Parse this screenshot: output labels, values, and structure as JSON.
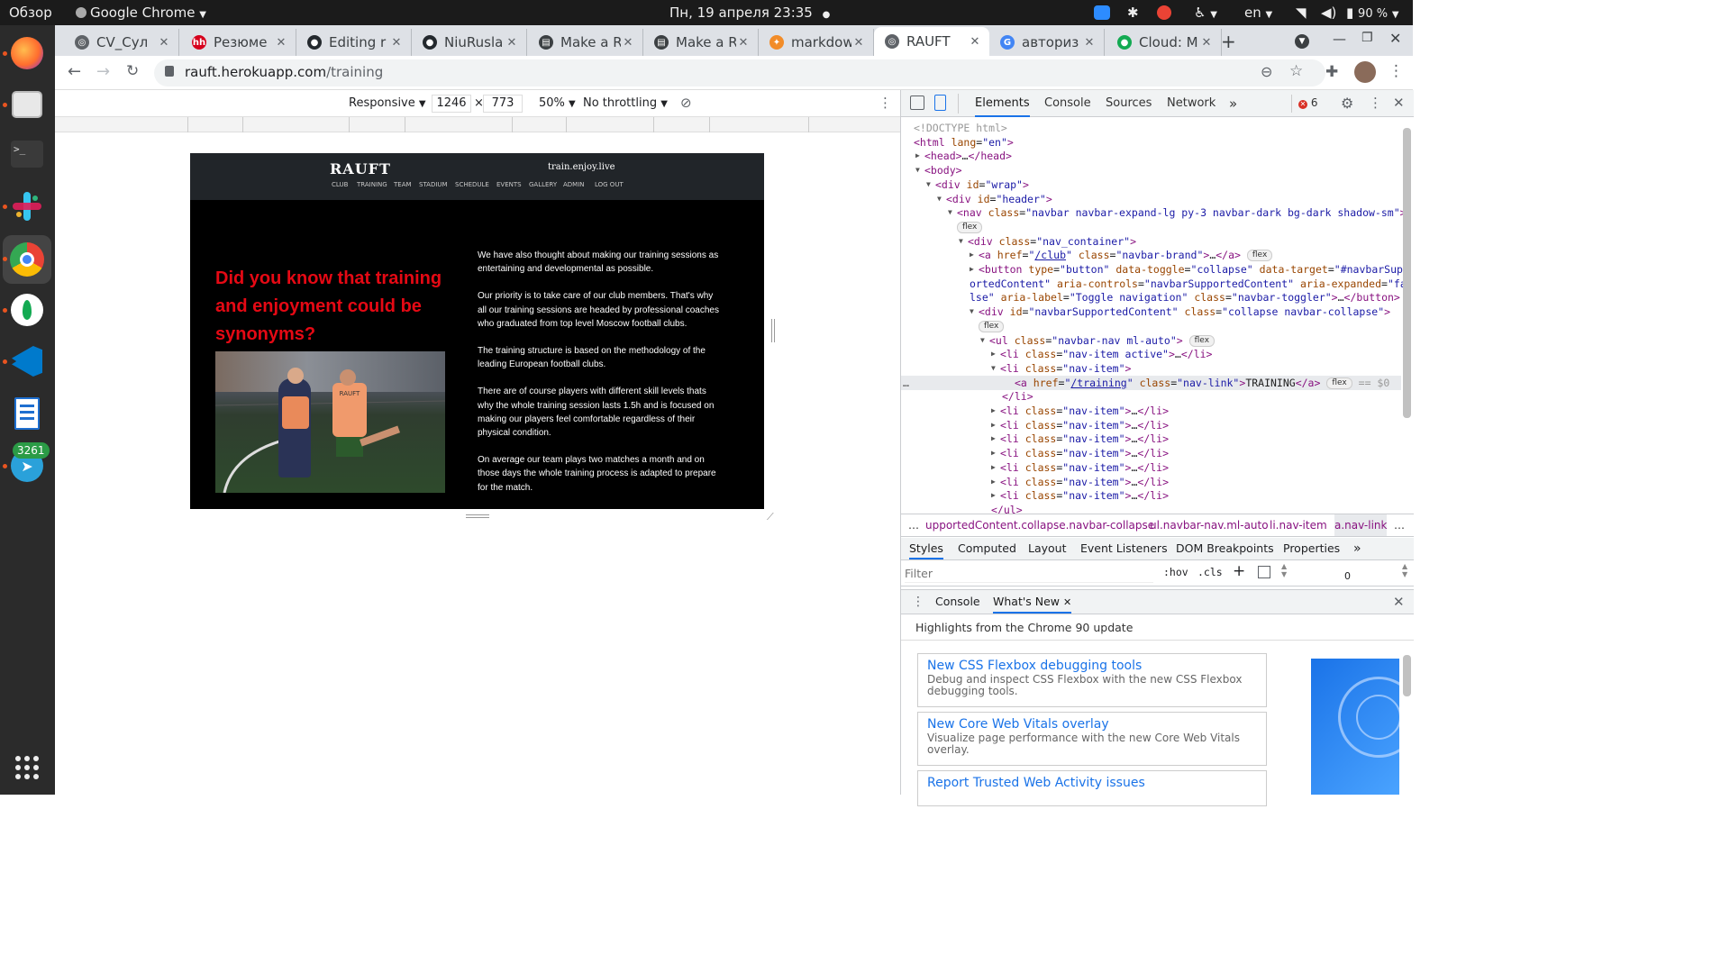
{
  "os": {
    "overview": "Обзор",
    "active_app": "Google Chrome",
    "clock": "Пн, 19 апреля  23:35",
    "language": "en",
    "battery": "90 %",
    "telegram_badge": "3261"
  },
  "dock": {
    "apps": [
      "firefox-icon",
      "files-icon",
      "terminal-icon",
      "slack-icon",
      "chrome-icon",
      "mongodb-compass-icon",
      "vscode-icon",
      "text-editor-icon",
      "telegram-icon"
    ],
    "grid": "apps-grid-icon"
  },
  "tabs": [
    {
      "label": "CV_Сул",
      "color": "#5f6368",
      "glyph": "◎"
    },
    {
      "label": "Резюме",
      "color": "#d6001c",
      "glyph": "hh"
    },
    {
      "label": "Editing r",
      "color": "#24292e",
      "glyph": "●"
    },
    {
      "label": "NiuRusla",
      "color": "#24292e",
      "glyph": "●"
    },
    {
      "label": "Make a R",
      "color": "#3c4043",
      "glyph": "▤"
    },
    {
      "label": "Make a R",
      "color": "#3c4043",
      "glyph": "▤"
    },
    {
      "label": "markdow",
      "color": "#f28c28",
      "glyph": "✦"
    },
    {
      "label": "RAUFT",
      "color": "#5f6368",
      "glyph": "◎"
    },
    {
      "label": "авториз",
      "color": "#4285f4",
      "glyph": "G"
    },
    {
      "label": "Cloud: M",
      "color": "#13aa52",
      "glyph": "●"
    }
  ],
  "address": {
    "host": "rauft.herokuapp.com",
    "path": "/training"
  },
  "device_toolbar": {
    "mode": "Responsive",
    "width": "1246",
    "times": "×",
    "height": "773",
    "zoom": "50%",
    "throttling": "No throttling"
  },
  "site": {
    "brand": "RAUFT",
    "tagline": "train.enjoy.live",
    "nav": [
      "CLUB",
      "TRAINING",
      "TEAM",
      "STADIUM",
      "SCHEDULE",
      "EVENTS",
      "GALLERY",
      "ADMIN",
      "LOG OUT"
    ],
    "headline_lines": [
      "Did you know that training",
      "and enjoyment could be",
      "synonyms?"
    ],
    "paragraphs": [
      [
        "We have also thought about making our training sessions as",
        "entertaining and developmental as possible."
      ],
      [
        "Our priority is to take care of our club members. That's why",
        "all our training sessions are headed by professional coaches",
        "who graduated from top level Moscow football clubs."
      ],
      [
        "The training structure is based on the methodology of the",
        "leading European football clubs."
      ],
      [
        "There are of course players with different skill levels thats",
        "why the whole training session lasts 1.5h and is focused on",
        "making our players feel comfortable regardless of their",
        "physical condition."
      ],
      [
        "On average our team plays two matches a month and on",
        "those days the whole training process is adapted to prepare",
        "for the match."
      ]
    ],
    "photo_bib": "RAUFT"
  },
  "devtools": {
    "tabs": [
      "Elements",
      "Console",
      "Sources",
      "Network"
    ],
    "more": "»",
    "error_count": "6",
    "breadcrumbs": [
      "…",
      "upportedContent.collapse.navbar-collapse",
      "ul.navbar-nav.ml-auto",
      "li.nav-item",
      "a.nav-link",
      "…"
    ],
    "style_tabs": [
      "Styles",
      "Computed",
      "Layout",
      "Event Listeners",
      "DOM Breakpoints",
      "Properties",
      "»"
    ],
    "filter_placeholder": "Filter",
    "hov": ":hov",
    "cls": ".cls",
    "box_value": "0",
    "drawer_tabs": [
      "Console",
      "What's New"
    ],
    "highlights": "Highlights from the Chrome 90 update",
    "cards": [
      {
        "title": "New CSS Flexbox debugging tools",
        "desc1": "Debug and inspect CSS Flexbox with the new CSS Flexbox",
        "desc2": "debugging tools."
      },
      {
        "title": "New Core Web Vitals overlay",
        "desc1": "Visualize page performance with the new Core Web Vitals",
        "desc2": "overlay."
      },
      {
        "title": "Report Trusted Web Activity issues",
        "desc1": "",
        "desc2": ""
      }
    ]
  },
  "dom_lines": [
    {
      "indent": 14,
      "arrow": "",
      "html": "<span class='cm'>&lt;!DOCTYPE html&gt;</span>"
    },
    {
      "indent": 14,
      "arrow": "",
      "html": "<span class='tg'>&lt;html</span> <span class='an'>lang</span>=<span class='av'>\"en\"</span><span class='tg'>&gt;</span>"
    },
    {
      "indent": 26,
      "arrow": "▶",
      "html": "<span class='tg'>&lt;head&gt;</span>…<span class='tg'>&lt;/head&gt;</span>"
    },
    {
      "indent": 26,
      "arrow": "▼",
      "html": "<span class='tg'>&lt;body&gt;</span>"
    },
    {
      "indent": 38,
      "arrow": "▼",
      "html": "<span class='tg'>&lt;div</span> <span class='an'>id</span>=<span class='av'>\"wrap\"</span><span class='tg'>&gt;</span>"
    },
    {
      "indent": 50,
      "arrow": "▼",
      "html": "<span class='tg'>&lt;div</span> <span class='an'>id</span>=<span class='av'>\"header\"</span><span class='tg'>&gt;</span>"
    },
    {
      "indent": 62,
      "arrow": "▼",
      "html": "<span class='tg'>&lt;nav</span> <span class='an'>class</span>=<span class='av'>\"navbar navbar-expand-lg py-3 navbar-dark bg-dark shadow-sm\"</span><span class='tg'>&gt;</span>"
    },
    {
      "indent": 62,
      "arrow": "",
      "html": "<span class='badge'>flex</span>"
    },
    {
      "indent": 74,
      "arrow": "▼",
      "html": "<span class='tg'>&lt;div</span> <span class='an'>class</span>=<span class='av'>\"nav_container\"</span><span class='tg'>&gt;</span>"
    },
    {
      "indent": 86,
      "arrow": "▶",
      "html": "<span class='tg'>&lt;a</span> <span class='an'>href</span>=<span class='av'>\"<span class='link'>/club</span>\"</span> <span class='an'>class</span>=<span class='av'>\"navbar-brand\"</span><span class='tg'>&gt;</span>…<span class='tg'>&lt;/a&gt;</span> <span class='badge'>flex</span>"
    },
    {
      "indent": 86,
      "arrow": "▶",
      "html": "<span class='tg'>&lt;button</span> <span class='an'>type</span>=<span class='av'>\"button\"</span> <span class='an'>data-toggle</span>=<span class='av'>\"collapse\"</span> <span class='an'>data-target</span>=<span class='av'>\"#navbarSupp</span>"
    },
    {
      "indent": 76,
      "arrow": "",
      "html": "<span class='av'>ortedContent\"</span> <span class='an'>aria-controls</span>=<span class='av'>\"navbarSupportedContent\"</span> <span class='an'>aria-expanded</span>=<span class='av'>\"fa</span>"
    },
    {
      "indent": 76,
      "arrow": "",
      "html": "<span class='av'>lse\"</span> <span class='an'>aria-label</span>=<span class='av'>\"Toggle navigation\"</span> <span class='an'>class</span>=<span class='av'>\"navbar-toggler\"</span><span class='tg'>&gt;</span>…<span class='tg'>&lt;/button&gt;</span>"
    },
    {
      "indent": 86,
      "arrow": "▼",
      "html": "<span class='tg'>&lt;div</span> <span class='an'>id</span>=<span class='av'>\"navbarSupportedContent\"</span> <span class='an'>class</span>=<span class='av'>\"collapse navbar-collapse\"</span><span class='tg'>&gt;</span>"
    },
    {
      "indent": 86,
      "arrow": "",
      "html": "<span class='badge'>flex</span>"
    },
    {
      "indent": 98,
      "arrow": "▼",
      "html": "<span class='tg'>&lt;ul</span> <span class='an'>class</span>=<span class='av'>\"navbar-nav ml-auto\"</span><span class='tg'>&gt;</span> <span class='badge'>flex</span>"
    },
    {
      "indent": 110,
      "arrow": "▶",
      "html": "<span class='tg'>&lt;li</span> <span class='an'>class</span>=<span class='av'>\"nav-item active\"</span><span class='tg'>&gt;</span>…<span class='tg'>&lt;/li&gt;</span>"
    },
    {
      "indent": 110,
      "arrow": "▼",
      "html": "<span class='tg'>&lt;li</span> <span class='an'>class</span>=<span class='av'>\"nav-item\"</span><span class='tg'>&gt;</span>"
    },
    {
      "indent": 126,
      "arrow": "",
      "html": "<span class='tg'>&lt;a</span> <span class='an'>href</span>=<span class='av'>\"<span class='link'>/training</span>\"</span> <span class='an'>class</span>=<span class='av'>\"nav-link\"</span><span class='tg'>&gt;</span><span class='tx2'>TRAINING</span><span class='tg'>&lt;/a&gt;</span> <span class='badge'>flex</span> <span class='cm'>== $0</span>",
      "selected": true
    },
    {
      "indent": 112,
      "arrow": "",
      "html": "<span class='tg'>&lt;/li&gt;</span>"
    },
    {
      "indent": 110,
      "arrow": "▶",
      "html": "<span class='tg'>&lt;li</span> <span class='an'>class</span>=<span class='av'>\"nav-item\"</span><span class='tg'>&gt;</span>…<span class='tg'>&lt;/li&gt;</span>"
    },
    {
      "indent": 110,
      "arrow": "▶",
      "html": "<span class='tg'>&lt;li</span> <span class='an'>class</span>=<span class='av'>\"nav-item\"</span><span class='tg'>&gt;</span>…<span class='tg'>&lt;/li&gt;</span>"
    },
    {
      "indent": 110,
      "arrow": "▶",
      "html": "<span class='tg'>&lt;li</span> <span class='an'>class</span>=<span class='av'>\"nav-item\"</span><span class='tg'>&gt;</span>…<span class='tg'>&lt;/li&gt;</span>"
    },
    {
      "indent": 110,
      "arrow": "▶",
      "html": "<span class='tg'>&lt;li</span> <span class='an'>class</span>=<span class='av'>\"nav-item\"</span><span class='tg'>&gt;</span>…<span class='tg'>&lt;/li&gt;</span>"
    },
    {
      "indent": 110,
      "arrow": "▶",
      "html": "<span class='tg'>&lt;li</span> <span class='an'>class</span>=<span class='av'>\"nav-item\"</span><span class='tg'>&gt;</span>…<span class='tg'>&lt;/li&gt;</span>"
    },
    {
      "indent": 110,
      "arrow": "▶",
      "html": "<span class='tg'>&lt;li</span> <span class='an'>class</span>=<span class='av'>\"nav-item\"</span><span class='tg'>&gt;</span>…<span class='tg'>&lt;/li&gt;</span>"
    },
    {
      "indent": 110,
      "arrow": "▶",
      "html": "<span class='tg'>&lt;li</span> <span class='an'>class</span>=<span class='av'>\"nav-item\"</span><span class='tg'>&gt;</span>…<span class='tg'>&lt;/li&gt;</span>"
    },
    {
      "indent": 100,
      "arrow": "",
      "html": "<span class='tg'>&lt;/ul&gt;</span>"
    }
  ]
}
